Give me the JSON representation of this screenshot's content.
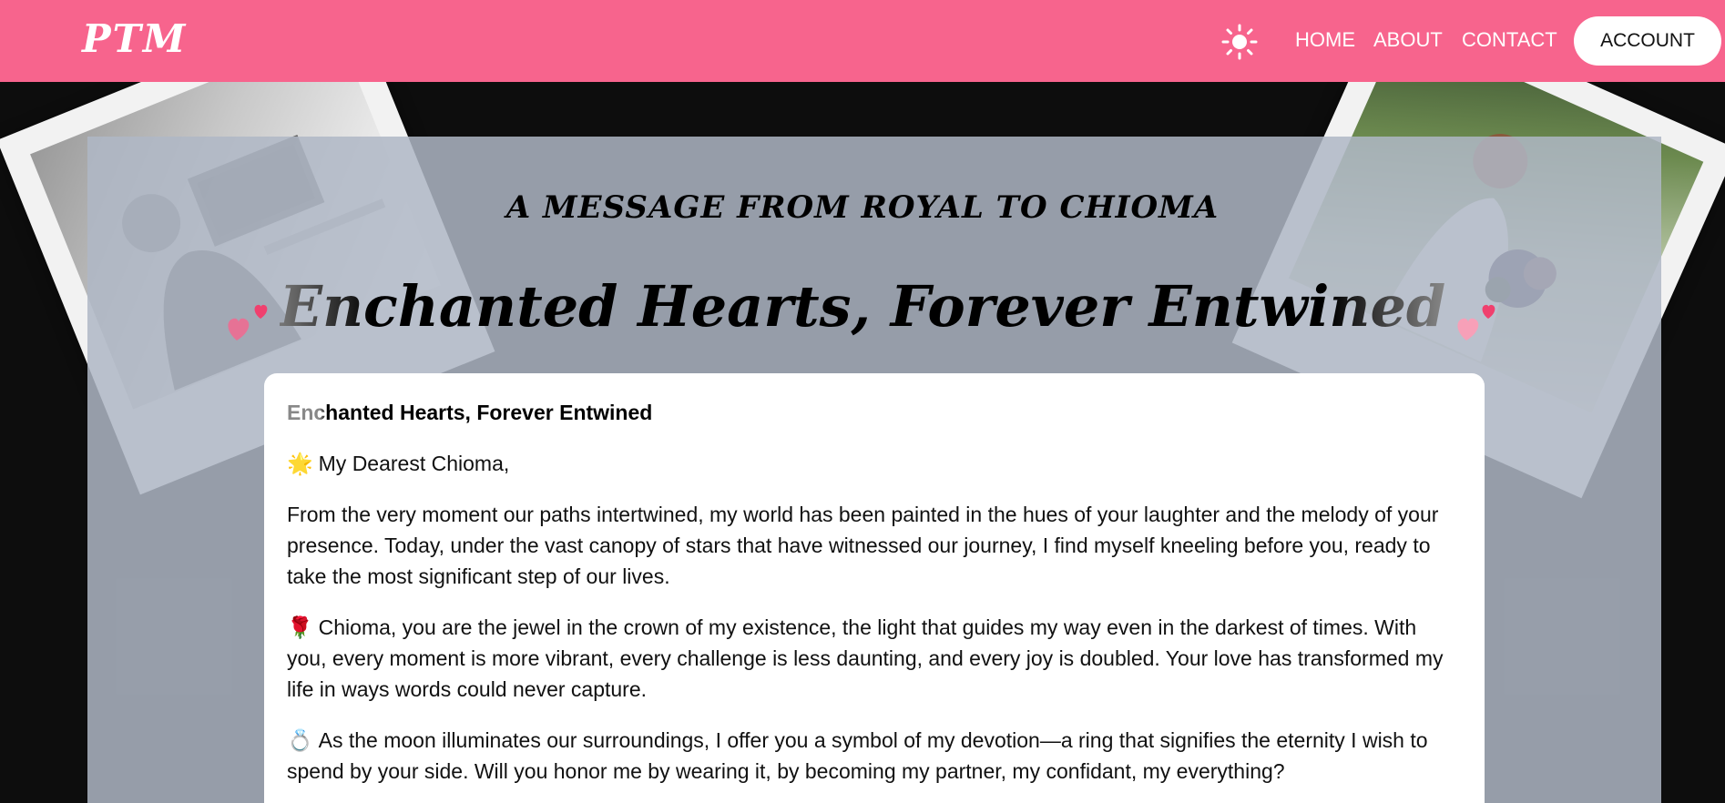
{
  "nav": {
    "logo": "PTM",
    "links": [
      "HOME",
      "ABOUT",
      "CONTACT"
    ],
    "account_label": "ACCOUNT",
    "theme_icon": "sun-icon"
  },
  "colors": {
    "nav_bg": "#f7648d",
    "page_bg": "#0d0d0d",
    "overlay": "#afb7c6",
    "heart": "#f7648d"
  },
  "hero": {
    "subtitle": "A MESSAGE FROM ROYAL TO CHIOMA",
    "title": "Enchanted Hearts, Forever Entwined"
  },
  "letter": {
    "heading": "Enchanted Hearts, Forever Entwined",
    "greeting_emoji": "🌟",
    "greeting": "My Dearest Chioma,",
    "p1": "From the very moment our paths intertwined, my world has been painted in the hues of your laughter and the melody of your presence. Today, under the vast canopy of stars that have witnessed our journey, I find myself kneeling before you, ready to take the most significant step of our lives.",
    "p2_emoji": "🌹",
    "p2": "Chioma, you are the jewel in the crown of my existence, the light that guides my way even in the darkest of times. With you, every moment is more vibrant, every challenge is less daunting, and every joy is doubled. Your love has transformed my life in ways words could never capture.",
    "p3_emoji": "💍",
    "p3": "As the moon illuminates our surroundings, I offer you a symbol of my devotion—a ring that signifies the eternity I wish to spend by your side. Will you honor me by wearing it, by becoming my partner, my confidant, my everything?"
  }
}
